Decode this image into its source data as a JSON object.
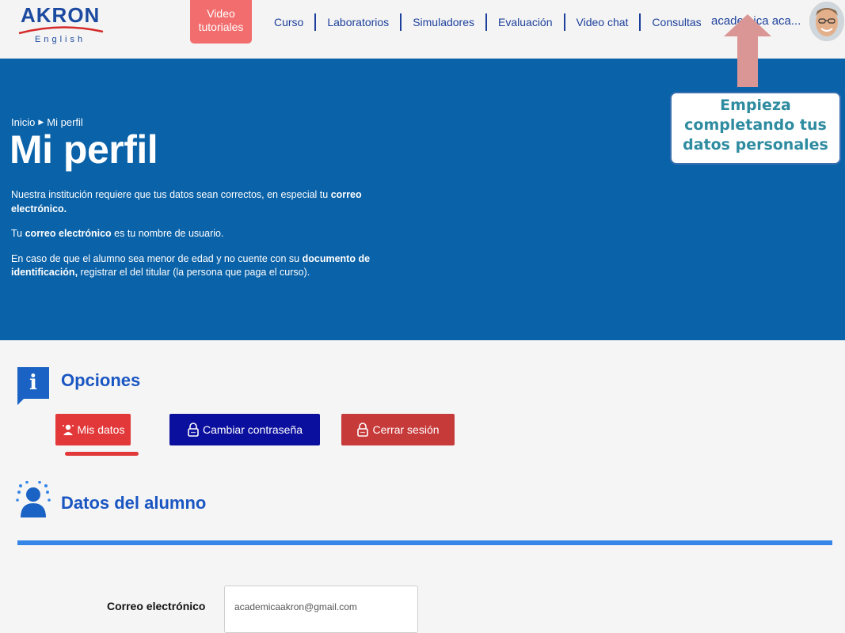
{
  "header": {
    "logo": {
      "brand": "AKRON",
      "sub": "English"
    },
    "video_button": "Video tutoriales",
    "nav": [
      "Curso",
      "Laboratorios",
      "Simuladores",
      "Evaluación",
      "Video chat",
      "Consultas"
    ],
    "user_name": "academica aca..."
  },
  "hero": {
    "breadcrumb": {
      "home": "Inicio",
      "current": "Mi perfil"
    },
    "title": "Mi perfil",
    "p1_a": "Nuestra institución requiere que tus datos sean correctos, en especial tu ",
    "p1_b": "correo electrónico.",
    "p2_a": "Tu ",
    "p2_b": "correo electrónico",
    "p2_c": " es tu nombre de usuario.",
    "p3_a": "En caso de que el alumno sea menor de edad y no cuente con su ",
    "p3_b": "documento de identificación,",
    "p3_c": " registrar el del titular (la persona que paga el curso)."
  },
  "callout": {
    "line1": "Empieza",
    "line2": "completando tus",
    "line3": "datos personales"
  },
  "options": {
    "title": "Opciones",
    "buttons": {
      "datos": "Mis datos",
      "password": "Cambiar contraseña",
      "logout": "Cerrar sesión"
    }
  },
  "student": {
    "title": "Datos del alumno",
    "email_label": "Correo electrónico",
    "email_value": "academicaakron@gmail.com"
  },
  "colors": {
    "hero_blue": "#0a62a8",
    "nav_blue": "#1c3f9c",
    "video_red": "#f26d6d",
    "btn_red": "#e2383a",
    "btn_navy": "#0b0f9e",
    "callout_arrow": "#d99694"
  }
}
